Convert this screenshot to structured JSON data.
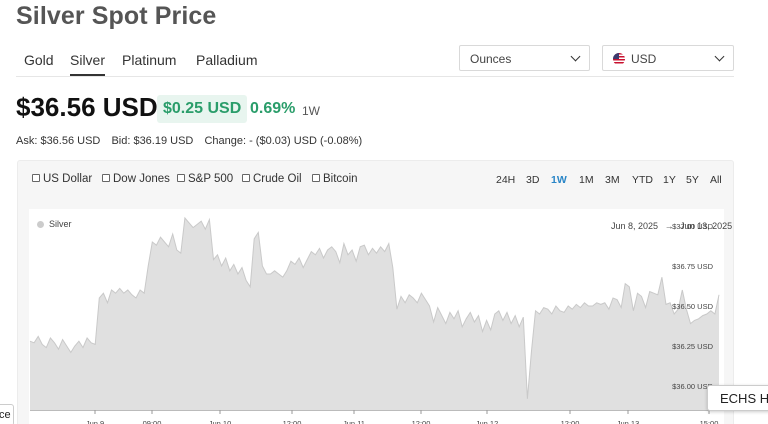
{
  "page": {
    "title": "Silver Spot Price"
  },
  "metal_tabs": [
    "Gold",
    "Silver",
    "Platinum",
    "Palladium"
  ],
  "active_tab": "Silver",
  "unit_select": {
    "value": "Ounces"
  },
  "currency_select": {
    "value": "USD",
    "flag_icon": "us-flag-icon"
  },
  "price": {
    "current": "$36.56 USD",
    "change": "$0.25 USD",
    "change_pct": "0.69%",
    "period": "1W",
    "change_color": "#2a9d6a"
  },
  "quote": {
    "ask": "Ask: $36.56 USD",
    "bid": "Bid: $36.19 USD",
    "change": "Change: - ($0.03) USD (-0.08%)"
  },
  "compare_options": [
    "US Dollar",
    "Dow Jones",
    "S&P 500",
    "Crude Oil",
    "Bitcoin"
  ],
  "ranges": [
    "24H",
    "3D",
    "1W",
    "1M",
    "3M",
    "YTD",
    "1Y",
    "5Y",
    "All"
  ],
  "active_range": "1W",
  "accent_color": "#2a86c7",
  "floating": {
    "badge": "ECHS H",
    "left_cut": "ce"
  },
  "chart_data": {
    "type": "area",
    "legend": "Silver",
    "date_range": {
      "from": "Jun 8, 2025",
      "arrow": "→",
      "to": "Jun 13, 2025"
    },
    "y_ticks": [
      "$37.00 USD",
      "$36.75 USD",
      "$36.50 USD",
      "$36.25 USD",
      "$36.00 USD"
    ],
    "y_tick_values": [
      37.0,
      36.75,
      36.5,
      36.25,
      36.0
    ],
    "x_ticks": [
      "Jun 9",
      "09:00",
      "Jun 10",
      "12:00",
      "Jun 11",
      "12:00",
      "Jun 12",
      "12:00",
      "Jun 13",
      "15:00"
    ],
    "ylim": [
      35.85,
      37.1
    ],
    "fill_color": "#e0e0e0",
    "line_color": "#c9c9c9",
    "series": [
      {
        "name": "Silver",
        "values": [
          36.28,
          36.27,
          36.31,
          36.26,
          36.24,
          36.3,
          36.27,
          36.23,
          36.29,
          36.25,
          36.21,
          36.25,
          36.28,
          36.24,
          36.3,
          36.27,
          36.26,
          36.55,
          36.58,
          36.52,
          36.6,
          36.58,
          36.61,
          36.58,
          36.6,
          36.57,
          36.55,
          36.6,
          36.58,
          36.75,
          36.9,
          36.88,
          36.93,
          36.9,
          36.87,
          36.95,
          36.85,
          36.83,
          37.05,
          37.02,
          36.99,
          37.01,
          37.03,
          36.98,
          37.04,
          36.79,
          36.82,
          36.75,
          36.8,
          36.72,
          36.76,
          36.7,
          36.74,
          36.66,
          36.62,
          36.92,
          36.96,
          36.75,
          36.7,
          36.7,
          36.72,
          36.7,
          36.68,
          36.72,
          36.78,
          36.76,
          36.8,
          36.74,
          36.79,
          36.84,
          36.82,
          36.86,
          36.8,
          36.85,
          36.87,
          36.84,
          36.77,
          36.89,
          36.82,
          36.85,
          36.78,
          36.87,
          36.88,
          36.82,
          36.86,
          36.83,
          36.87,
          36.84,
          36.89,
          36.74,
          36.48,
          36.56,
          36.52,
          36.57,
          36.55,
          36.52,
          36.58,
          36.54,
          36.5,
          36.4,
          36.49,
          36.44,
          36.39,
          36.46,
          36.42,
          36.47,
          36.37,
          36.42,
          36.46,
          36.4,
          36.44,
          36.34,
          36.41,
          36.35,
          36.45,
          36.47,
          36.41,
          36.46,
          36.39,
          36.44,
          36.37,
          36.43,
          35.92,
          36.22,
          36.47,
          36.45,
          36.49,
          36.48,
          36.45,
          36.5,
          36.47,
          36.46,
          36.5,
          36.48,
          36.51,
          36.49,
          36.52,
          36.5,
          36.5,
          36.52,
          36.51,
          36.52,
          36.48,
          36.55,
          36.54,
          36.49,
          36.64,
          36.62,
          36.47,
          36.58,
          36.56,
          36.49,
          36.59,
          36.58,
          36.57,
          36.68,
          36.51,
          36.52,
          36.45,
          36.48,
          36.6,
          36.48,
          36.39,
          36.41,
          36.42,
          36.44,
          36.45,
          36.47,
          36.45,
          36.57
        ]
      }
    ]
  }
}
